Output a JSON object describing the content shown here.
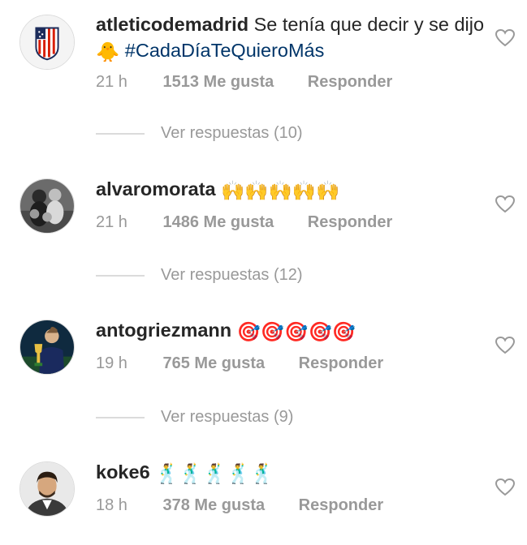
{
  "comments": [
    {
      "username": "atleticodemadrid",
      "text": "Se tenía que decir y se dijo",
      "emoji": "🐥",
      "hashtag": "#CadaDíaTeQuieroMás",
      "time": "21 h",
      "likes": "1513 Me gusta",
      "reply": "Responder",
      "replies": "Ver respuestas (10)",
      "avatar_icon": "atletico-crest-icon"
    },
    {
      "username": "alvaromorata",
      "emoji": "🙌🙌🙌🙌🙌",
      "time": "21 h",
      "likes": "1486 Me gusta",
      "reply": "Responder",
      "replies": "Ver respuestas (12)",
      "avatar_icon": "family-photo-avatar"
    },
    {
      "username": "antogriezmann",
      "emoji": "🎯🎯🎯🎯🎯",
      "time": "19 h",
      "likes": "765 Me gusta",
      "reply": "Responder",
      "replies": "Ver respuestas (9)",
      "avatar_icon": "trophy-photo-avatar"
    },
    {
      "username": "koke6",
      "emoji": "🕺🕺🕺🕺🕺",
      "time": "18 h",
      "likes": "378 Me gusta",
      "reply": "Responder",
      "avatar_icon": "portrait-photo-avatar"
    }
  ],
  "colors": {
    "text": "#262626",
    "meta": "#999999",
    "hashtag": "#003569",
    "divider": "#dbdbdb"
  }
}
